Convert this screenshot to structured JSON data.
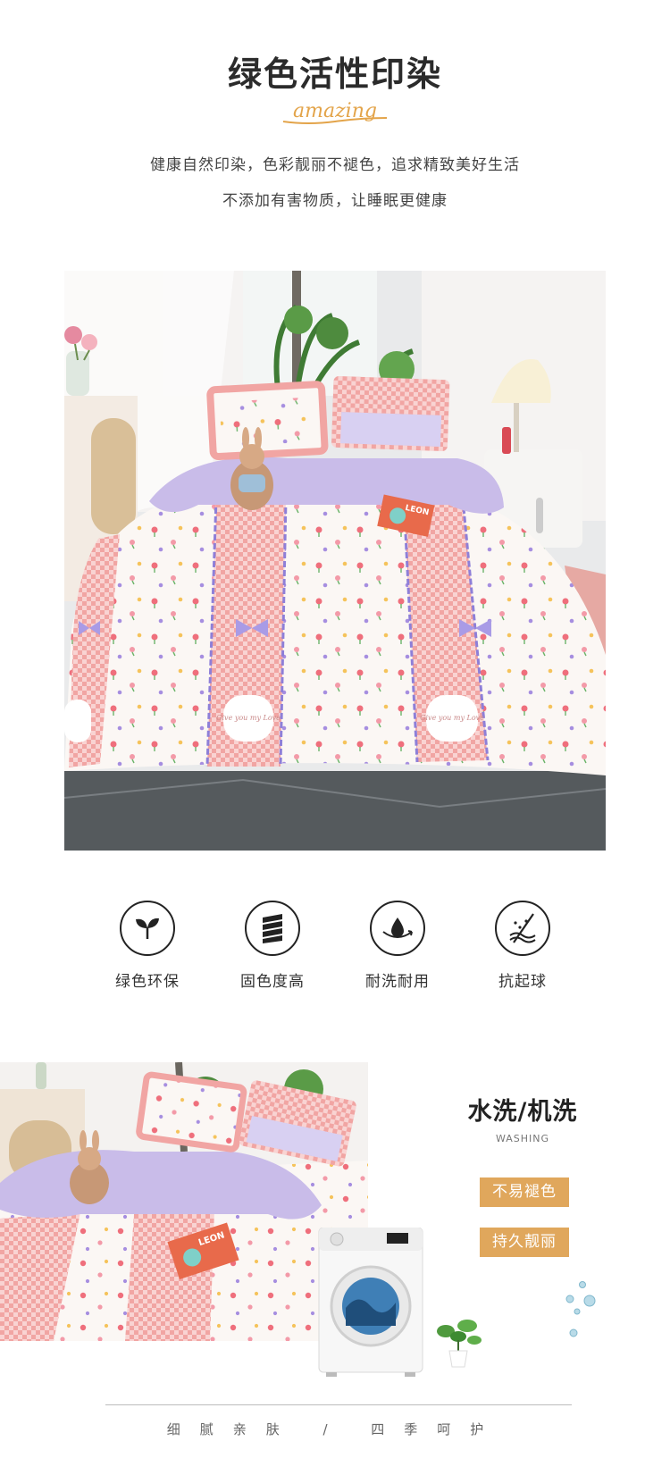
{
  "header": {
    "title": "绿色活性印染",
    "script_word": "amazing",
    "line1": "健康自然印染，色彩靓丽不褪色，追求精致美好生活",
    "line2": "不添加有害物质，让睡眠更健康"
  },
  "photo1": {
    "book_text": "LEON",
    "heart_text": "Give you my Love"
  },
  "features": [
    {
      "label": "绿色环保",
      "icon": "leaf-icon"
    },
    {
      "label": "固色度高",
      "icon": "twist-fiber-icon"
    },
    {
      "label": "耐洗耐用",
      "icon": "water-drop-icon"
    },
    {
      "label": "抗起球",
      "icon": "anti-pilling-icon"
    }
  ],
  "washing": {
    "title": "水洗/机洗",
    "subtitle": "WASHING",
    "tags": [
      "不易褪色",
      "持久靓丽"
    ],
    "book_text": "LEON"
  },
  "footer": {
    "text": "细腻亲肤 / 四季呵护"
  },
  "colors": {
    "accent": "#e0a75c",
    "pink_check": "#f3a9a7",
    "lavender": "#c9b8e8"
  }
}
